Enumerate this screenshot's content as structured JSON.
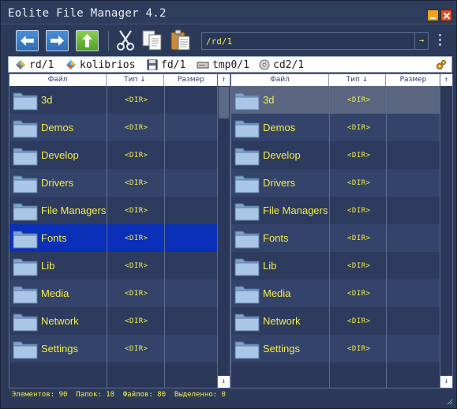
{
  "window": {
    "title": "Eolite File Manager 4.2"
  },
  "toolbar": {
    "back_icon": "arrow-left-icon",
    "forward_icon": "arrow-right-icon",
    "up_icon": "arrow-up-icon",
    "cut_icon": "scissors-icon",
    "copy_icon": "copy-icon",
    "paste_icon": "paste-icon",
    "address": "/rd/1",
    "go_label": "→"
  },
  "drives": [
    {
      "label": "rd/1",
      "icon": "ramdisk-icon"
    },
    {
      "label": "kolibrios",
      "icon": "kolibrios-icon"
    },
    {
      "label": "fd/1",
      "icon": "floppy-icon"
    },
    {
      "label": "tmp0/1",
      "icon": "harddisk-icon"
    },
    {
      "label": "cd2/1",
      "icon": "cdrom-icon"
    }
  ],
  "columns": {
    "name": "Файл",
    "type": "Тип ↓",
    "size": "Размер",
    "scroll_up": "↑",
    "scroll_down": "↓"
  },
  "files": [
    {
      "name": "3d",
      "type": "<DIR>"
    },
    {
      "name": "Demos",
      "type": "<DIR>"
    },
    {
      "name": "Develop",
      "type": "<DIR>"
    },
    {
      "name": "Drivers",
      "type": "<DIR>"
    },
    {
      "name": "File Managers",
      "type": "<DIR>"
    },
    {
      "name": "Fonts",
      "type": "<DIR>"
    },
    {
      "name": "Lib",
      "type": "<DIR>"
    },
    {
      "name": "Media",
      "type": "<DIR>"
    },
    {
      "name": "Network",
      "type": "<DIR>"
    },
    {
      "name": "Settings",
      "type": "<DIR>"
    }
  ],
  "left_panel": {
    "selected_index": 5
  },
  "right_panel": {
    "cursor_index": 0
  },
  "status": "Элементов: 90  Папок: 10  Файлов: 80  Выделенно: 0",
  "colors": {
    "accent_text": "#f4ec4a",
    "selection": "#0a2fb8",
    "background": "#2c3a59"
  }
}
